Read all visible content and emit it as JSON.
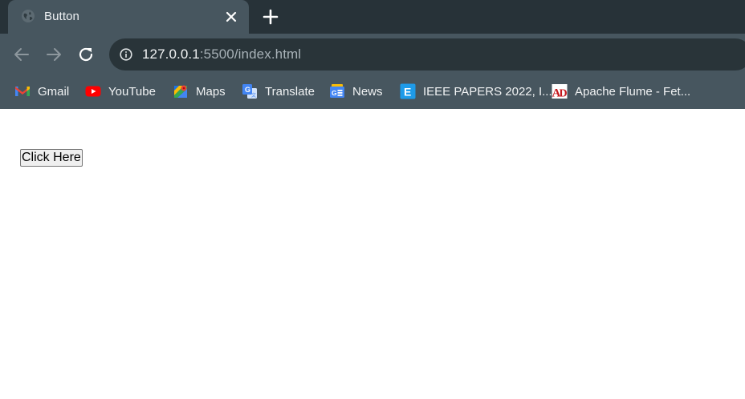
{
  "tab": {
    "title": "Button",
    "favicon": "globe-icon",
    "close_icon": "close-icon",
    "new_tab_icon": "plus-icon"
  },
  "toolbar": {
    "back_icon": "back-arrow-icon",
    "forward_icon": "forward-arrow-icon",
    "reload_icon": "reload-icon",
    "info_icon": "info-icon",
    "url_host": "127.0.0.1",
    "url_rest": ":5500/index.html"
  },
  "bookmarks": [
    {
      "label": "Gmail",
      "icon": "gmail-icon"
    },
    {
      "label": "YouTube",
      "icon": "youtube-icon"
    },
    {
      "label": "Maps",
      "icon": "maps-icon"
    },
    {
      "label": "Translate",
      "icon": "translate-icon"
    },
    {
      "label": "News",
      "icon": "news-icon"
    },
    {
      "label": "IEEE PAPERS 2022, I...",
      "icon": "ieee-e-icon"
    },
    {
      "label": "Apache Flume - Fet...",
      "icon": "apache-ad-icon"
    }
  ],
  "page": {
    "button_label": "Click Here"
  },
  "colors": {
    "tabstrip_bg": "#273238",
    "toolbar_bg": "#47565f",
    "omnibox_bg": "#293439",
    "page_bg": "#ffffff"
  }
}
